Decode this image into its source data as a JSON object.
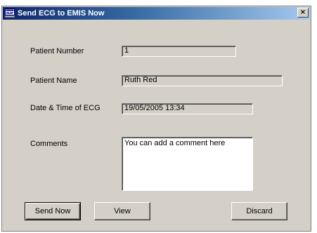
{
  "window": {
    "title": "Send ECG to EMIS Now",
    "close_label": "×"
  },
  "form": {
    "patient_number_label": "Patient Number",
    "patient_number_value": "1",
    "patient_name_label": "Patient Name",
    "patient_name_value": "Ruth Red",
    "ecg_datetime_label": "Date & Time of ECG",
    "ecg_datetime_value": "19/05/2005 13:34",
    "comments_label": "Comments",
    "comments_value": "You can add a comment here"
  },
  "buttons": {
    "send_now": "Send Now",
    "view": "View",
    "discard": "Discard"
  },
  "icons": {
    "app": "app-window-icon",
    "close": "close-icon"
  }
}
